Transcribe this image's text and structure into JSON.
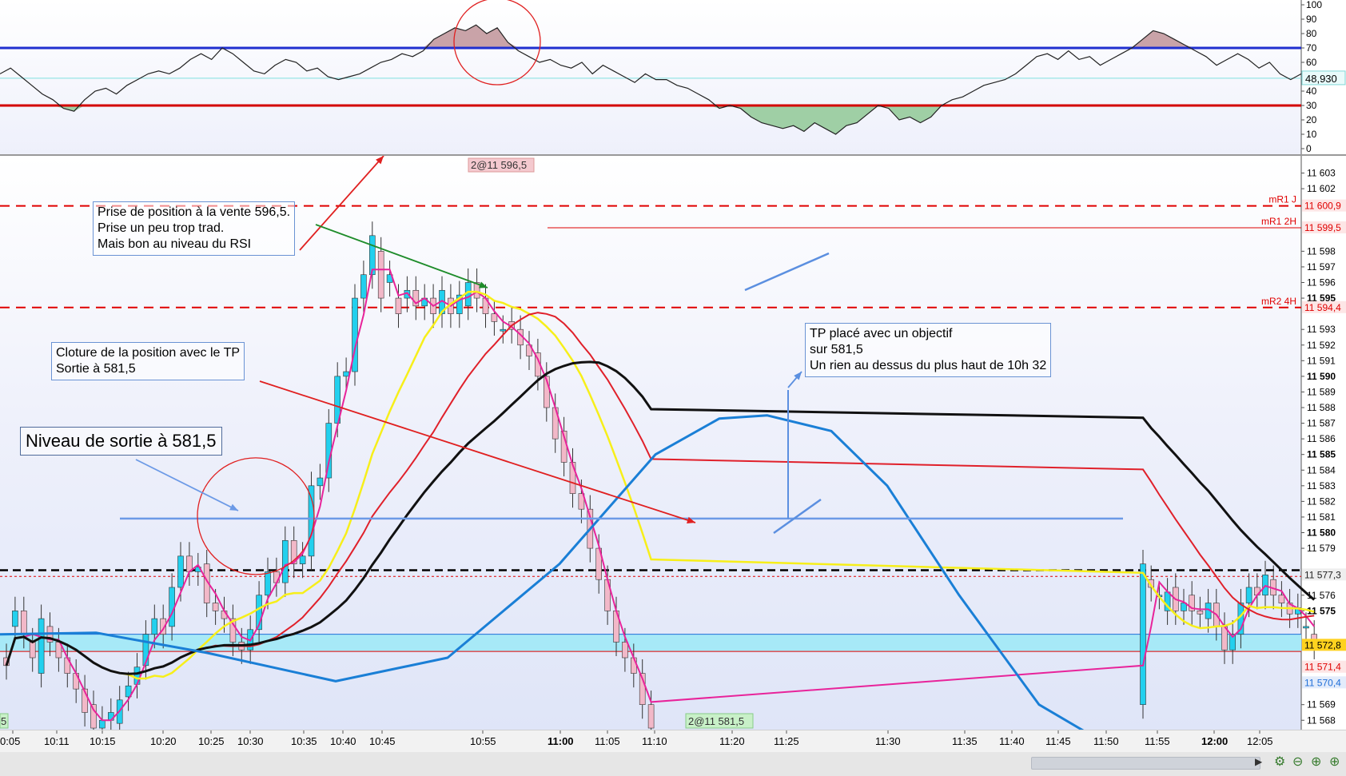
{
  "chart_data": [
    {
      "type": "line",
      "panel": "RSI",
      "ylim": [
        0,
        100
      ],
      "y_ticks": [
        "100",
        "90",
        "80",
        "70",
        "60",
        "50",
        "40",
        "30",
        "20",
        "10",
        "0"
      ],
      "levels": [
        {
          "value": 70,
          "color": "#1f2fd0"
        },
        {
          "value": 30,
          "color": "#d40000"
        }
      ],
      "current_value_label": "48,930",
      "series": [
        {
          "color": "#222222",
          "values": [
            52,
            56,
            50,
            44,
            38,
            34,
            28,
            26,
            34,
            40,
            42,
            38,
            44,
            48,
            52,
            54,
            52,
            56,
            62,
            66,
            62,
            70,
            66,
            60,
            54,
            52,
            58,
            62,
            60,
            54,
            56,
            50,
            48,
            50,
            52,
            56,
            60,
            62,
            66,
            64,
            68,
            76,
            80,
            84,
            82,
            86,
            80,
            84,
            74,
            68,
            64,
            60,
            62,
            58,
            56,
            60,
            52,
            58,
            54,
            50,
            46,
            52,
            48,
            48,
            44,
            42,
            38,
            34,
            28,
            30,
            28,
            22,
            18,
            16,
            14,
            16,
            12,
            18,
            14,
            10,
            16,
            18,
            24,
            30,
            28,
            20,
            22,
            18,
            22,
            30,
            34,
            36,
            40,
            44,
            46,
            48,
            52,
            58,
            64,
            66,
            62,
            68,
            62,
            64,
            58,
            62,
            66,
            70,
            76,
            82,
            80,
            76,
            72,
            68,
            64,
            58,
            62,
            66,
            62,
            56,
            60,
            52,
            48,
            52
          ]
        }
      ]
    },
    {
      "type": "candlestick",
      "panel": "price",
      "ylim": [
        11567.4,
        11604.0
      ],
      "y_ticks": [
        {
          "value": 11603,
          "label": "11 603"
        },
        {
          "value": 11602,
          "label": "11 602"
        },
        {
          "value": 11598,
          "label": "11 598"
        },
        {
          "value": 11597,
          "label": "11 597"
        },
        {
          "value": 11596,
          "label": "11 596"
        },
        {
          "value": 11595,
          "label": "11 595"
        },
        {
          "value": 11593,
          "label": "11 593"
        },
        {
          "value": 11592,
          "label": "11 592"
        },
        {
          "value": 11591,
          "label": "11 591"
        },
        {
          "value": 11590,
          "label": "11 590"
        },
        {
          "value": 11589,
          "label": "11 589"
        },
        {
          "value": 11588,
          "label": "11 588"
        },
        {
          "value": 11587,
          "label": "11 587"
        },
        {
          "value": 11586,
          "label": "11 586"
        },
        {
          "value": 11585,
          "label": "11 585"
        },
        {
          "value": 11584,
          "label": "11 584"
        },
        {
          "value": 11583,
          "label": "11 583"
        },
        {
          "value": 11582,
          "label": "11 582"
        },
        {
          "value": 11581,
          "label": "11 581"
        },
        {
          "value": 11580,
          "label": "11 580"
        },
        {
          "value": 11579,
          "label": "11 579"
        },
        {
          "value": 11576,
          "label": "11 576"
        },
        {
          "value": 11575,
          "label": "11 575"
        },
        {
          "value": 11569,
          "label": "11 569"
        },
        {
          "value": 11568,
          "label": "11 568"
        }
      ],
      "bold_ticks": [
        11595,
        11590,
        11585,
        11580,
        11575
      ],
      "x_ticks": [
        "0:05",
        "10:11",
        "10:15",
        "10:20",
        "10:25",
        "10:30",
        "10:35",
        "10:40",
        "10:45",
        "10:55",
        "11:00",
        "11:05",
        "11:10",
        "11:20",
        "11:25",
        "11:30",
        "11:35",
        "11:40",
        "11:45",
        "11:50",
        "11:55",
        "12:00",
        "12:05"
      ],
      "bold_x_ticks": [
        "11:00",
        "12:00"
      ],
      "price_tags": [
        {
          "label": "11 600,9",
          "value": 11600.9,
          "color": "#e00000",
          "bg": "#fde6e6"
        },
        {
          "label": "11 599,5",
          "value": 11599.5,
          "color": "#e00000",
          "bg": "#fde6e6"
        },
        {
          "label": "11 594,4",
          "value": 11594.4,
          "color": "#e00000",
          "bg": "#fde6e6"
        },
        {
          "label": "11 577,3",
          "value": 11577.3,
          "color": "#222222",
          "bg": "#eeeeee"
        },
        {
          "label": "11 572,8",
          "value": 11572.8,
          "color": "#000000",
          "bg": "#ffd21f"
        },
        {
          "label": "11 571,4",
          "value": 11571.4,
          "color": "#e00000",
          "bg": "#fde6e6"
        },
        {
          "label": "11 570,4",
          "value": 11570.4,
          "color": "#1f6ed8",
          "bg": "#e3ecfb"
        }
      ],
      "pivot_lines": [
        {
          "label": "mR1 J",
          "value": 11600.9,
          "style": "dashed"
        },
        {
          "label": "mR1 2H",
          "value": 11599.5,
          "style": "solid"
        },
        {
          "label": "mR2 4H",
          "value": 11594.4,
          "style": "dashed"
        }
      ],
      "trade_markers": [
        {
          "label": "2@11 596,5",
          "price": 11596.5
        },
        {
          "label": "2@11 581,5",
          "price": 11581.5
        },
        {
          "label": "5",
          "price": 11567.5
        }
      ],
      "exit_level": 11580.9,
      "candles_o": [
        11572,
        11574,
        11575,
        11573,
        11571,
        11574,
        11573,
        11572,
        11571,
        11570,
        11569,
        11567.5,
        11568,
        11567.8,
        11569.5,
        11570.3,
        11571.5,
        11573.5,
        11574.5,
        11574.0,
        11576.5,
        11578.5,
        11577.5,
        11578,
        11575.5,
        11575,
        11574.5,
        11573,
        11572.5,
        11573.8,
        11576,
        11577.5,
        11576.8,
        11579.5,
        11578,
        11578.5,
        11583,
        11583.5,
        11587,
        11590,
        11590.3,
        11595,
        11596.5,
        11598,
        11596,
        11595,
        11595,
        11595.5,
        11594.5,
        11595,
        11594,
        11595,
        11594,
        11594.5,
        11596,
        11595,
        11594,
        11593,
        11593.5,
        11593,
        11592,
        11591.5,
        11590,
        11588,
        11586.5,
        11584.5,
        11582.5,
        11581.5,
        11579,
        11577,
        11575,
        11573,
        11572,
        11571,
        11569
      ],
      "candles_c": [
        11571.5,
        11575,
        11573.5,
        11572,
        11574.5,
        11573,
        11572,
        11571,
        11570,
        11568.5,
        11567.5,
        11568,
        11568.5,
        11569.3,
        11570.2,
        11571.4,
        11573.5,
        11574.5,
        11573.5,
        11576.5,
        11578.5,
        11577.5,
        11577.8,
        11575.5,
        11575,
        11574.5,
        11573,
        11572.5,
        11573.8,
        11576,
        11577.5,
        11576.8,
        11579.5,
        11578,
        11578.5,
        11583,
        11583.5,
        11587,
        11590,
        11590.3,
        11595,
        11596.5,
        11599,
        11595,
        11596.5,
        11594,
        11595.5,
        11594.5,
        11595,
        11594,
        11595.5,
        11594,
        11595.2,
        11596,
        11595,
        11594,
        11593.5,
        11593,
        11593,
        11592,
        11591.3,
        11590,
        11588,
        11586,
        11584.5,
        11582.5,
        11581.5,
        11579,
        11577,
        11575,
        11573,
        11572,
        11571,
        11569,
        11567.5
      ],
      "candles_right": {
        "o": [
          11569,
          11577,
          11576,
          11575,
          11576.5,
          11575,
          11576,
          11575,
          11574.5,
          11575.5,
          11574,
          11572.5,
          11573.5,
          11575.5,
          11576.5,
          11576,
          11577,
          11576,
          11575.5,
          11574.8,
          11574,
          11573.5
        ],
        "c": [
          11578,
          11576.5,
          11576,
          11576.2,
          11575,
          11575.5,
          11575,
          11574.8,
          11575.5,
          11574,
          11572.5,
          11573.5,
          11575.5,
          11576.5,
          11576,
          11577.3,
          11576,
          11575.5,
          11574.8,
          11575.2,
          11574,
          11572.8
        ]
      },
      "lines": [
        {
          "name_hint": "blue-curve",
          "color": "#1a7fd6"
        },
        {
          "name_hint": "yellow-ma",
          "color": "#f7ef1a"
        },
        {
          "name_hint": "red-ma",
          "color": "#e0202a"
        },
        {
          "name_hint": "black-ma",
          "color": "#111111"
        },
        {
          "name_hint": "magenta-ma",
          "color": "#e8239a"
        }
      ]
    }
  ],
  "annotations": {
    "entry": {
      "lines": [
        "Prise de position à la vente 596,5.",
        "Prise un peu trop trad.",
        "Mais bon au niveau du RSI"
      ]
    },
    "closing": {
      "lines": [
        "Cloture de la position avec le TP",
        "Sortie à 581,5"
      ]
    },
    "exit_level": {
      "lines": [
        "Niveau de sortie à 581,5"
      ]
    },
    "target": {
      "lines": [
        "TP placé avec un objectif",
        "sur 581,5",
        "Un rien au dessus du plus haut de 10h 32"
      ]
    }
  },
  "colors": {
    "bull": "#22d0ee",
    "bear": "#f2b8c8",
    "up_line": "#1f2fd0",
    "down_line": "#d40000"
  }
}
